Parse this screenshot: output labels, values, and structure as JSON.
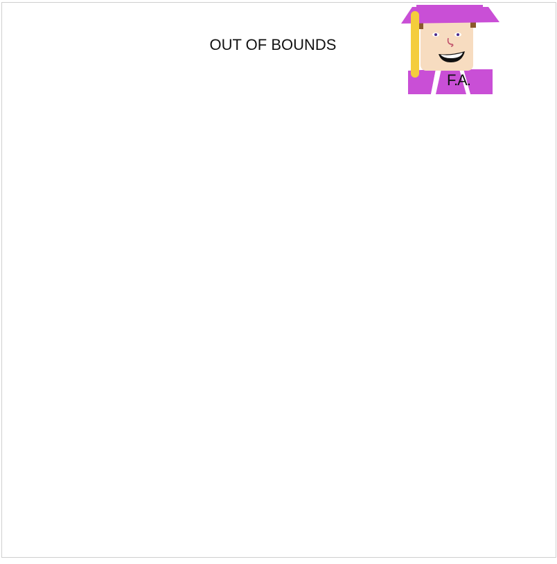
{
  "game": {
    "status_text": "OUT OF BOUNDS",
    "player": {
      "initials": "F.A.",
      "icon": "graduate-avatar-icon"
    }
  },
  "colors": {
    "gown": "#c94fd6",
    "cap": "#c94fd6",
    "tassel": "#f4cd3c",
    "skin": "#f7dcc0",
    "hair": "#8a5a2b",
    "border": "#cfcfcf",
    "text": "#111111"
  }
}
